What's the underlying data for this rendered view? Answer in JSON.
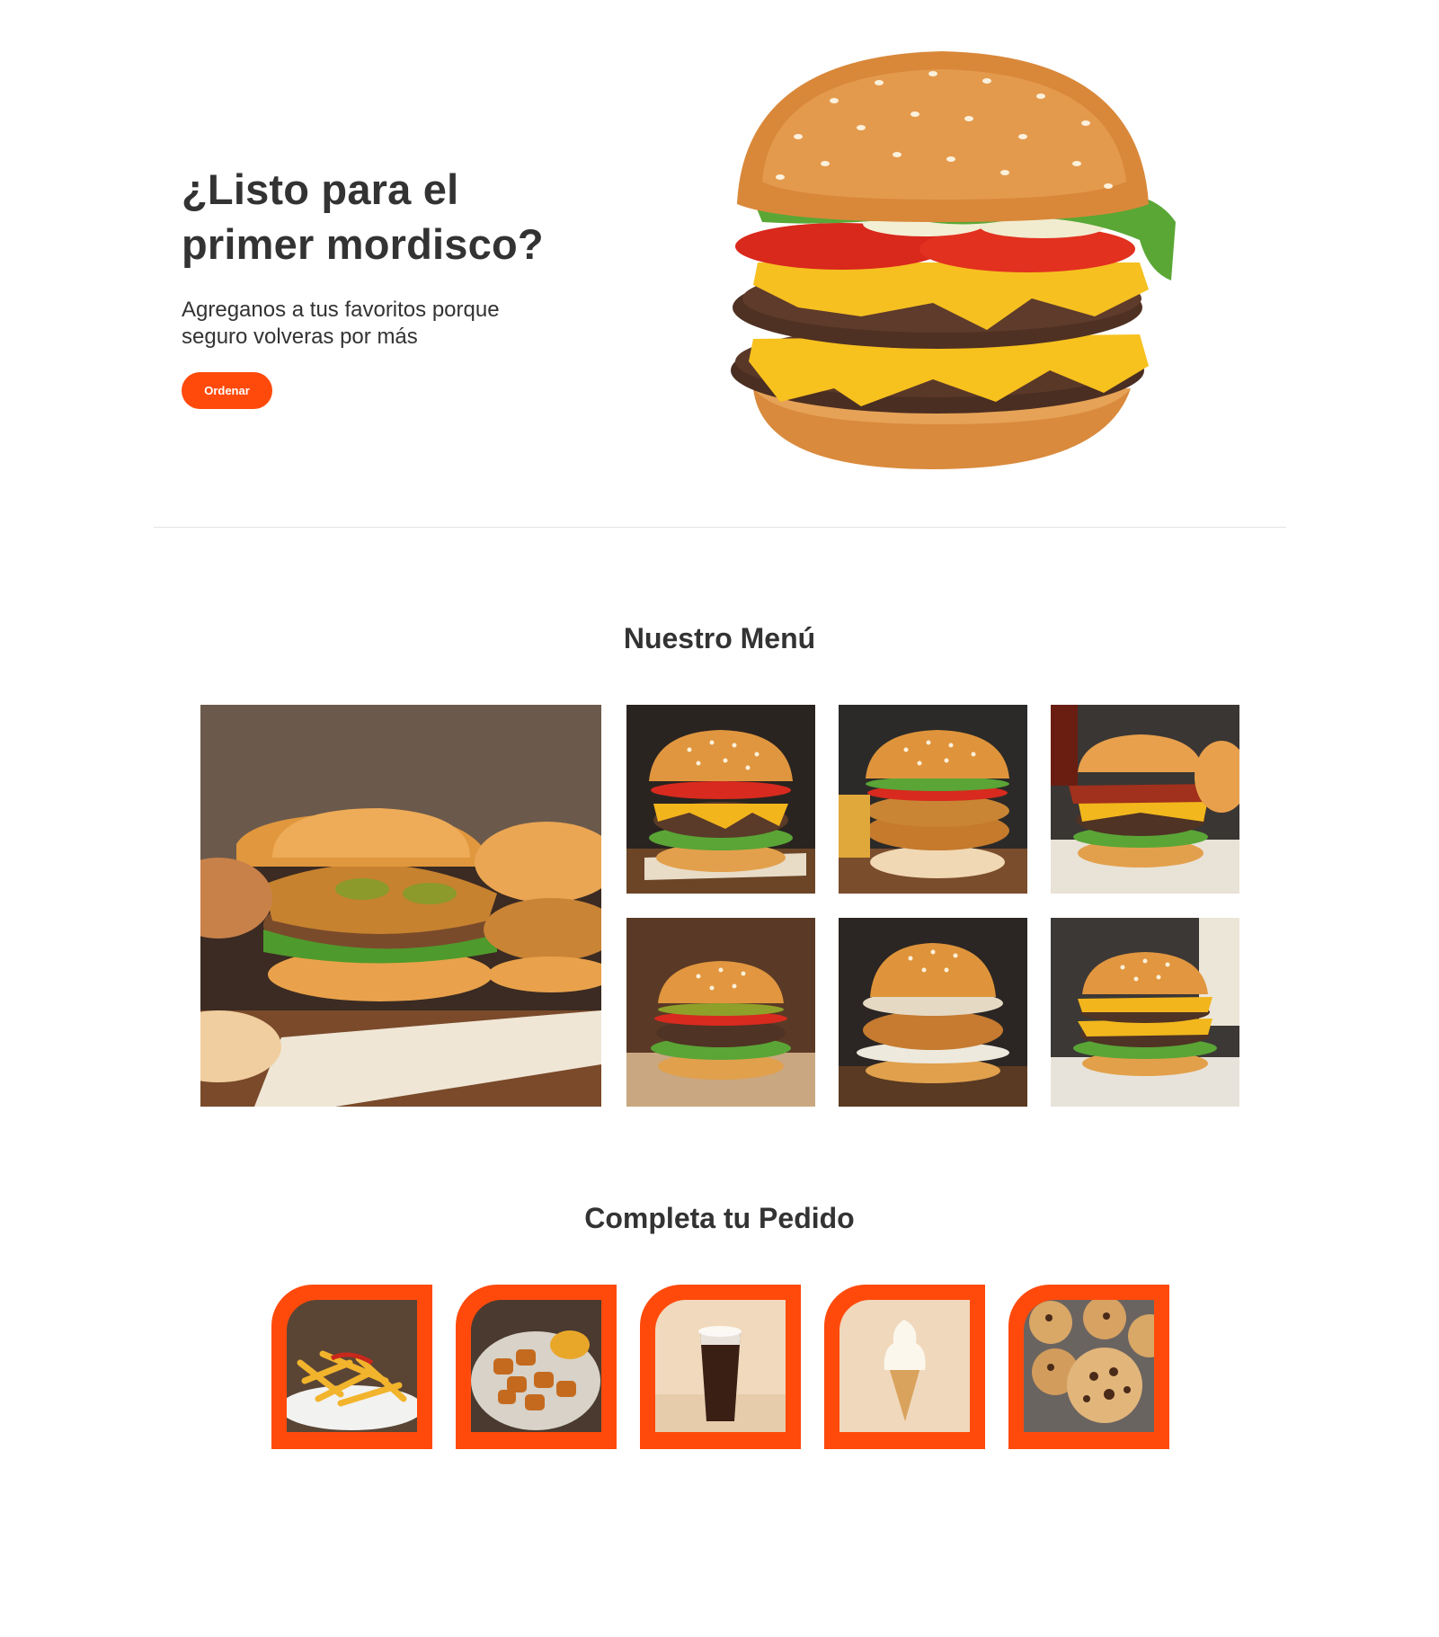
{
  "hero": {
    "title_line1": "¿Listo para el",
    "title_line2": "primer mordisco?",
    "subtitle_line1": "Agreganos a tus favoritos porque",
    "subtitle_line2": "seguro volveras por más",
    "order_button": "Ordenar"
  },
  "menu": {
    "title": "Nuestro Menú",
    "items": [
      {
        "icon": "chicken-burger-photo"
      },
      {
        "icon": "cheeseburger-photo"
      },
      {
        "icon": "crispy-chicken-burger-photo"
      },
      {
        "icon": "bacon-burger-photo"
      },
      {
        "icon": "pickle-burger-photo"
      },
      {
        "icon": "coleslaw-chicken-burger-photo"
      },
      {
        "icon": "double-cheeseburger-photo"
      }
    ]
  },
  "sides": {
    "title": "Completa tu Pedido",
    "items": [
      {
        "icon": "fries-photo"
      },
      {
        "icon": "nuggets-photo"
      },
      {
        "icon": "soda-photo"
      },
      {
        "icon": "ice-cream-photo"
      },
      {
        "icon": "cookies-photo"
      }
    ]
  },
  "colors": {
    "accent": "#ff4a0c",
    "text": "#333333",
    "divider": "#e4e4e4"
  }
}
